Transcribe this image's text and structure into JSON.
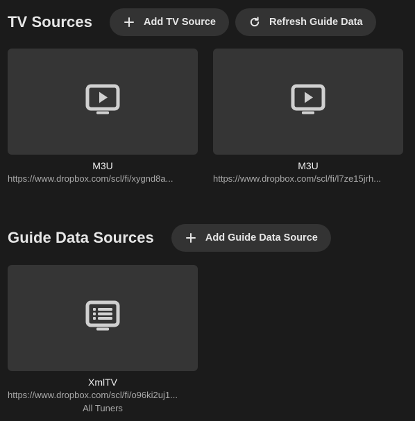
{
  "tv_sources": {
    "title": "TV Sources",
    "add_button_label": "Add TV Source",
    "refresh_button_label": "Refresh Guide Data",
    "cards": [
      {
        "title": "M3U",
        "url": "https://www.dropbox.com/scl/fi/xygnd8a...",
        "icon": "tv-play-icon"
      },
      {
        "title": "M3U",
        "url": "https://www.dropbox.com/scl/fi/l7ze15jrh...",
        "icon": "tv-play-icon"
      }
    ]
  },
  "guide_sources": {
    "title": "Guide Data Sources",
    "add_button_label": "Add Guide Data Source",
    "cards": [
      {
        "title": "XmlTV",
        "url": "https://www.dropbox.com/scl/fi/o96ki2uj1...",
        "subtitle": "All Tuners",
        "icon": "guide-list-icon"
      }
    ]
  },
  "colors": {
    "background": "#1b1b1b",
    "button": "#333333",
    "card": "#353535",
    "icon": "#d0d0d0"
  }
}
